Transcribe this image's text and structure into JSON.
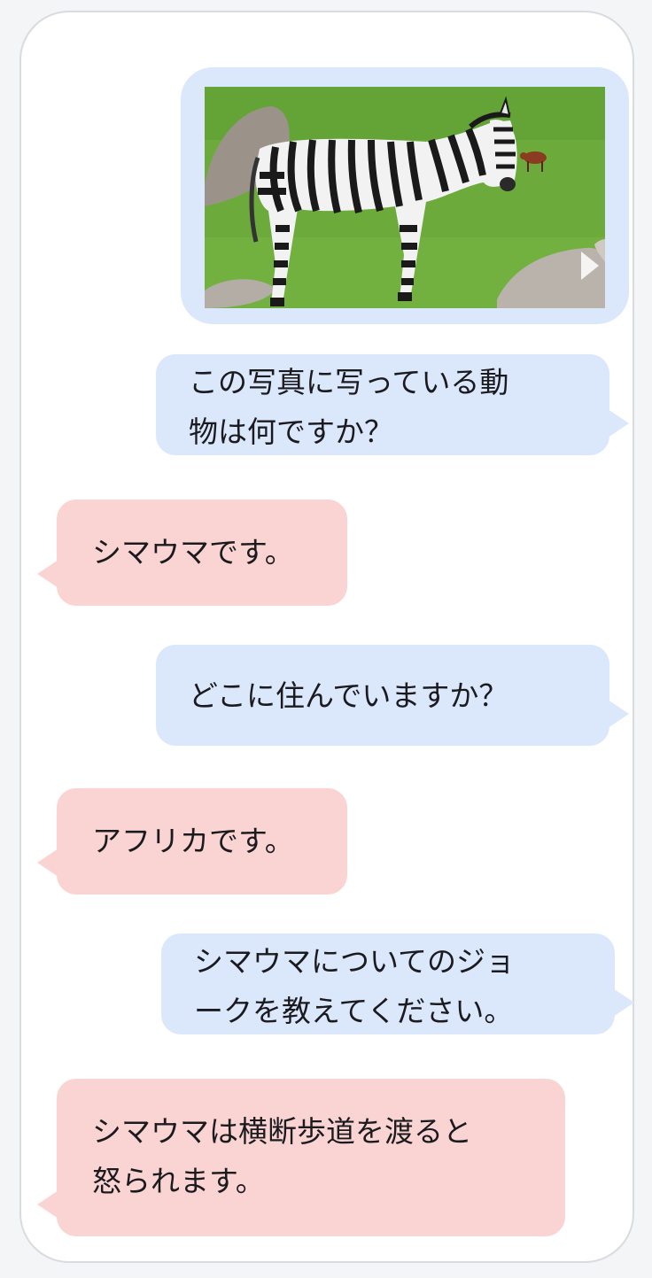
{
  "colors": {
    "user_bubble": "#dbe7fb",
    "bot_bubble": "#f9d4d3",
    "phone_bg": "#ffffff",
    "grass": "#6cab3b"
  },
  "image": {
    "subject_icon": "zebra-photo"
  },
  "messages": [
    {
      "role": "user",
      "text": "この写真に写っている動\n物は何ですか？"
    },
    {
      "role": "bot",
      "text": "シマウマです。"
    },
    {
      "role": "user",
      "text": "どこに住んでいますか？"
    },
    {
      "role": "bot",
      "text": "アフリカです。"
    },
    {
      "role": "user",
      "text": "シマウマについてのジョ\nークを教えてください。"
    },
    {
      "role": "bot",
      "text": "シマウマは横断歩道を渡ると\n怒られます。"
    }
  ]
}
